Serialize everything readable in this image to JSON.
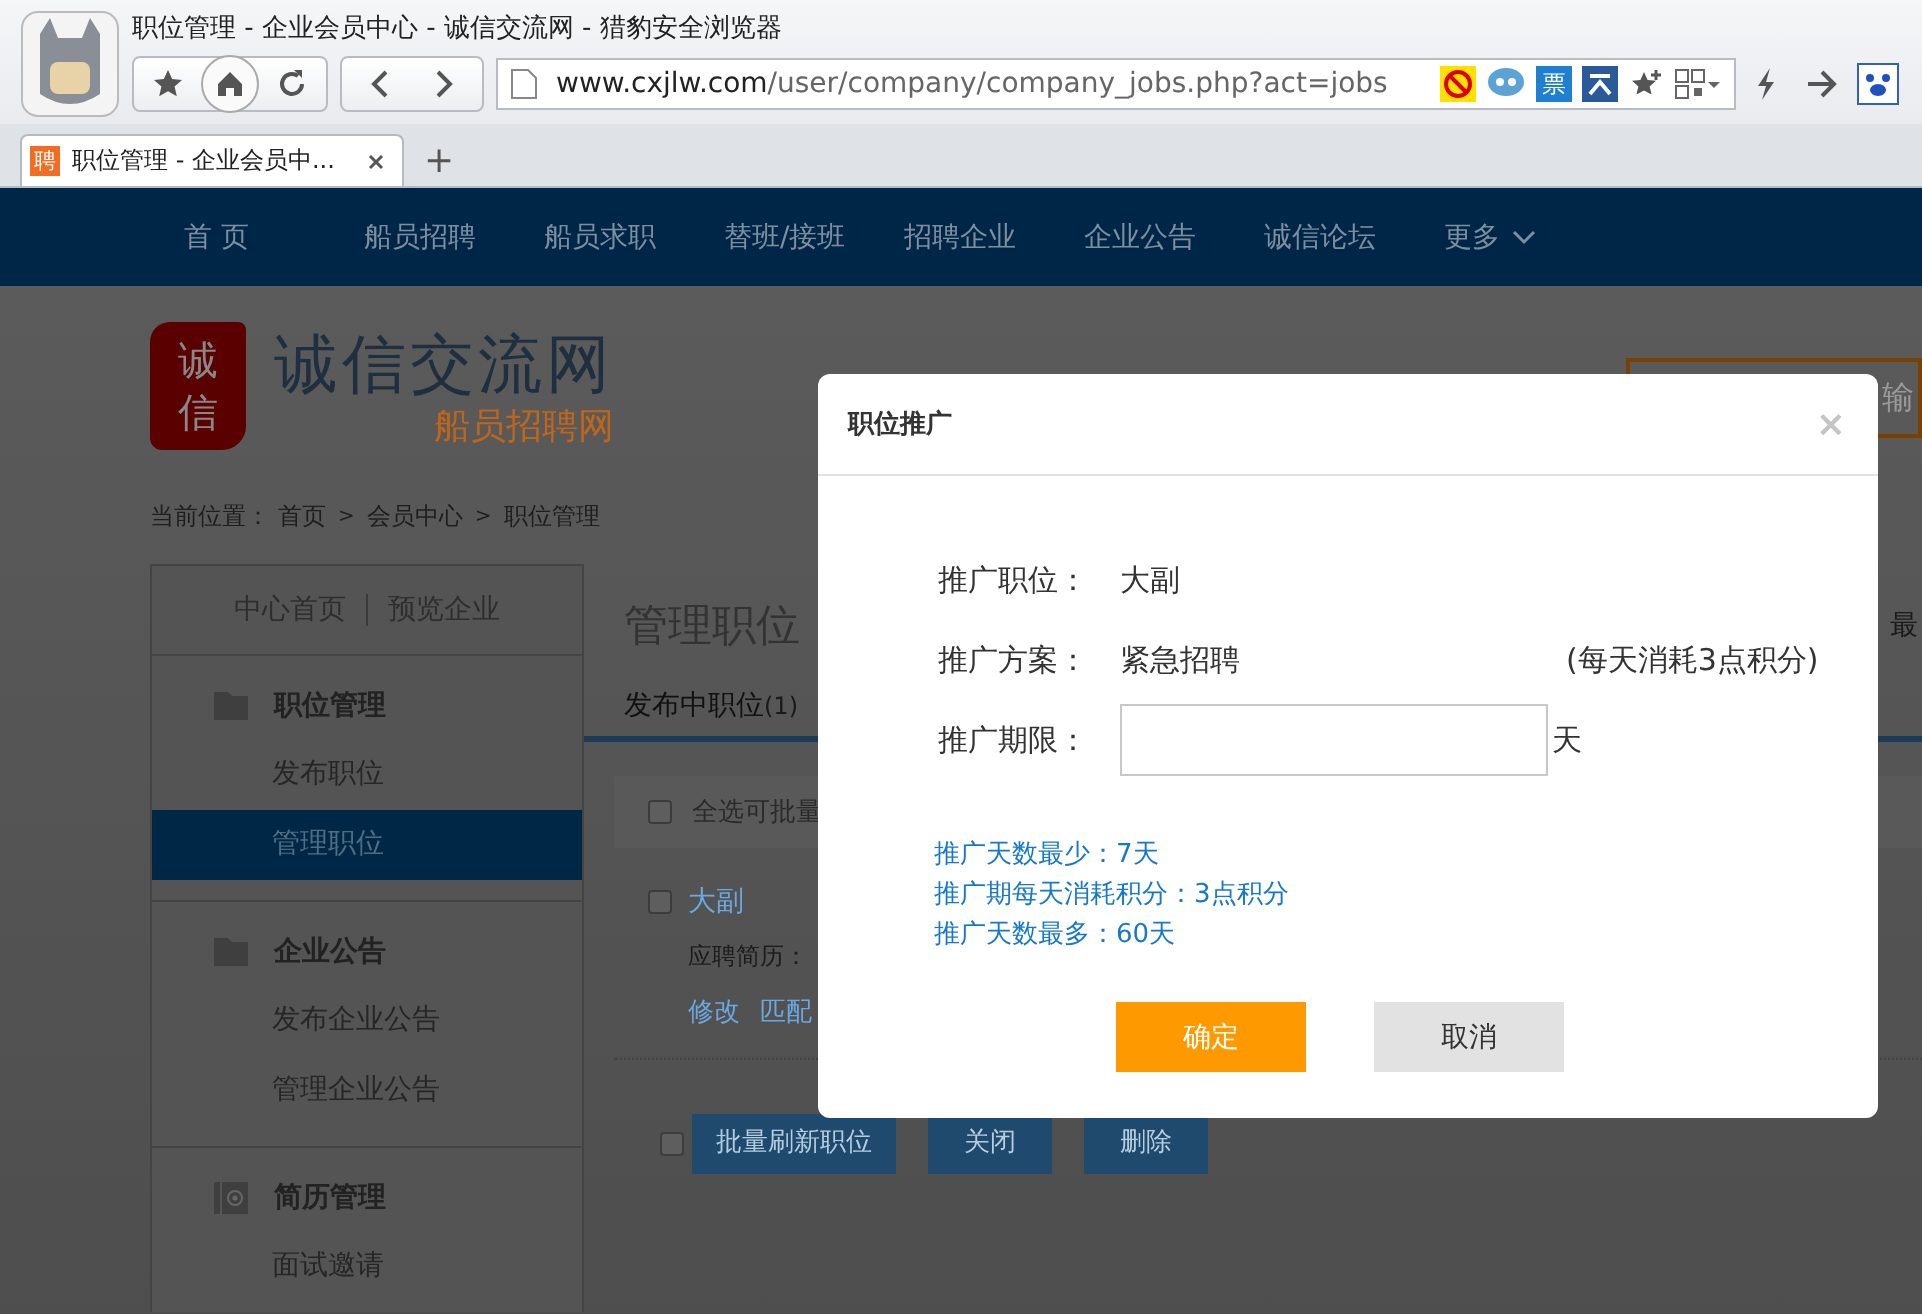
{
  "browser": {
    "window_title": "职位管理 - 企业会员中心 - 诚信交流网 - 猎豹安全浏览器",
    "address": {
      "host": "www.cxjlw.com",
      "path": "/user/company/company_jobs.php?act=jobs"
    },
    "extension_label": "票",
    "tabs": [
      {
        "favicon": "聘",
        "title": "职位管理 - 企业会员中...",
        "selected": true
      }
    ],
    "new_tab": "+"
  },
  "nav": {
    "items": [
      "首 页",
      "船员招聘",
      "船员求职",
      "替班/接班",
      "招聘企业",
      "企业公告",
      "诚信论坛",
      "更多"
    ]
  },
  "header": {
    "seal": "诚信",
    "site_name": "诚信交流网",
    "subtitle": "船员招聘网",
    "search_placeholder": "输"
  },
  "breadcrumb": {
    "label": "当前位置：",
    "separator": ">",
    "items": [
      "首页",
      "会员中心",
      "职位管理"
    ]
  },
  "sidebar": {
    "links": [
      "中心首页",
      "预览企业"
    ],
    "sections": [
      {
        "kind": "folder",
        "title": "职位管理",
        "items": [
          {
            "label": "发布职位",
            "selected": false
          },
          {
            "label": "管理职位",
            "selected": true
          }
        ]
      },
      {
        "kind": "folder",
        "title": "企业公告",
        "items": [
          {
            "label": "发布企业公告",
            "selected": false
          },
          {
            "label": "管理企业公告",
            "selected": false
          }
        ]
      },
      {
        "kind": "contact",
        "title": "简历管理",
        "items": [
          {
            "label": "面试邀请",
            "selected": false
          }
        ]
      }
    ]
  },
  "main": {
    "title": "管理职位",
    "aside": "最",
    "tabs": [
      {
        "label": "发布中职位",
        "count": "(1)",
        "selected": true
      }
    ],
    "select_all": {
      "label": "全选可批量",
      "checked": false
    },
    "jobs": [
      {
        "title": "大副",
        "checked": false,
        "resumes": "应聘简历：",
        "actions": [
          "修改",
          "匹配"
        ]
      }
    ],
    "bulk": {
      "checked": false,
      "buttons": [
        "批量刷新职位",
        "关闭",
        "删除"
      ]
    }
  },
  "dialog": {
    "title": "职位推广",
    "close": "×",
    "rows": [
      {
        "label": "推广职位：",
        "value": "大副"
      },
      {
        "label": "推广方案：",
        "value": "紧急招聘",
        "note": "(每天消耗3点积分)"
      }
    ],
    "duration": {
      "label": "推广期限：",
      "unit": "天"
    },
    "hints": [
      "推广天数最少：7天",
      "推广期每天消耗积分：3点积分",
      "推广天数最多：60天"
    ],
    "buttons": [
      {
        "label": "确定",
        "kind": "primary"
      },
      {
        "label": "取消",
        "kind": "secondary"
      }
    ]
  }
}
